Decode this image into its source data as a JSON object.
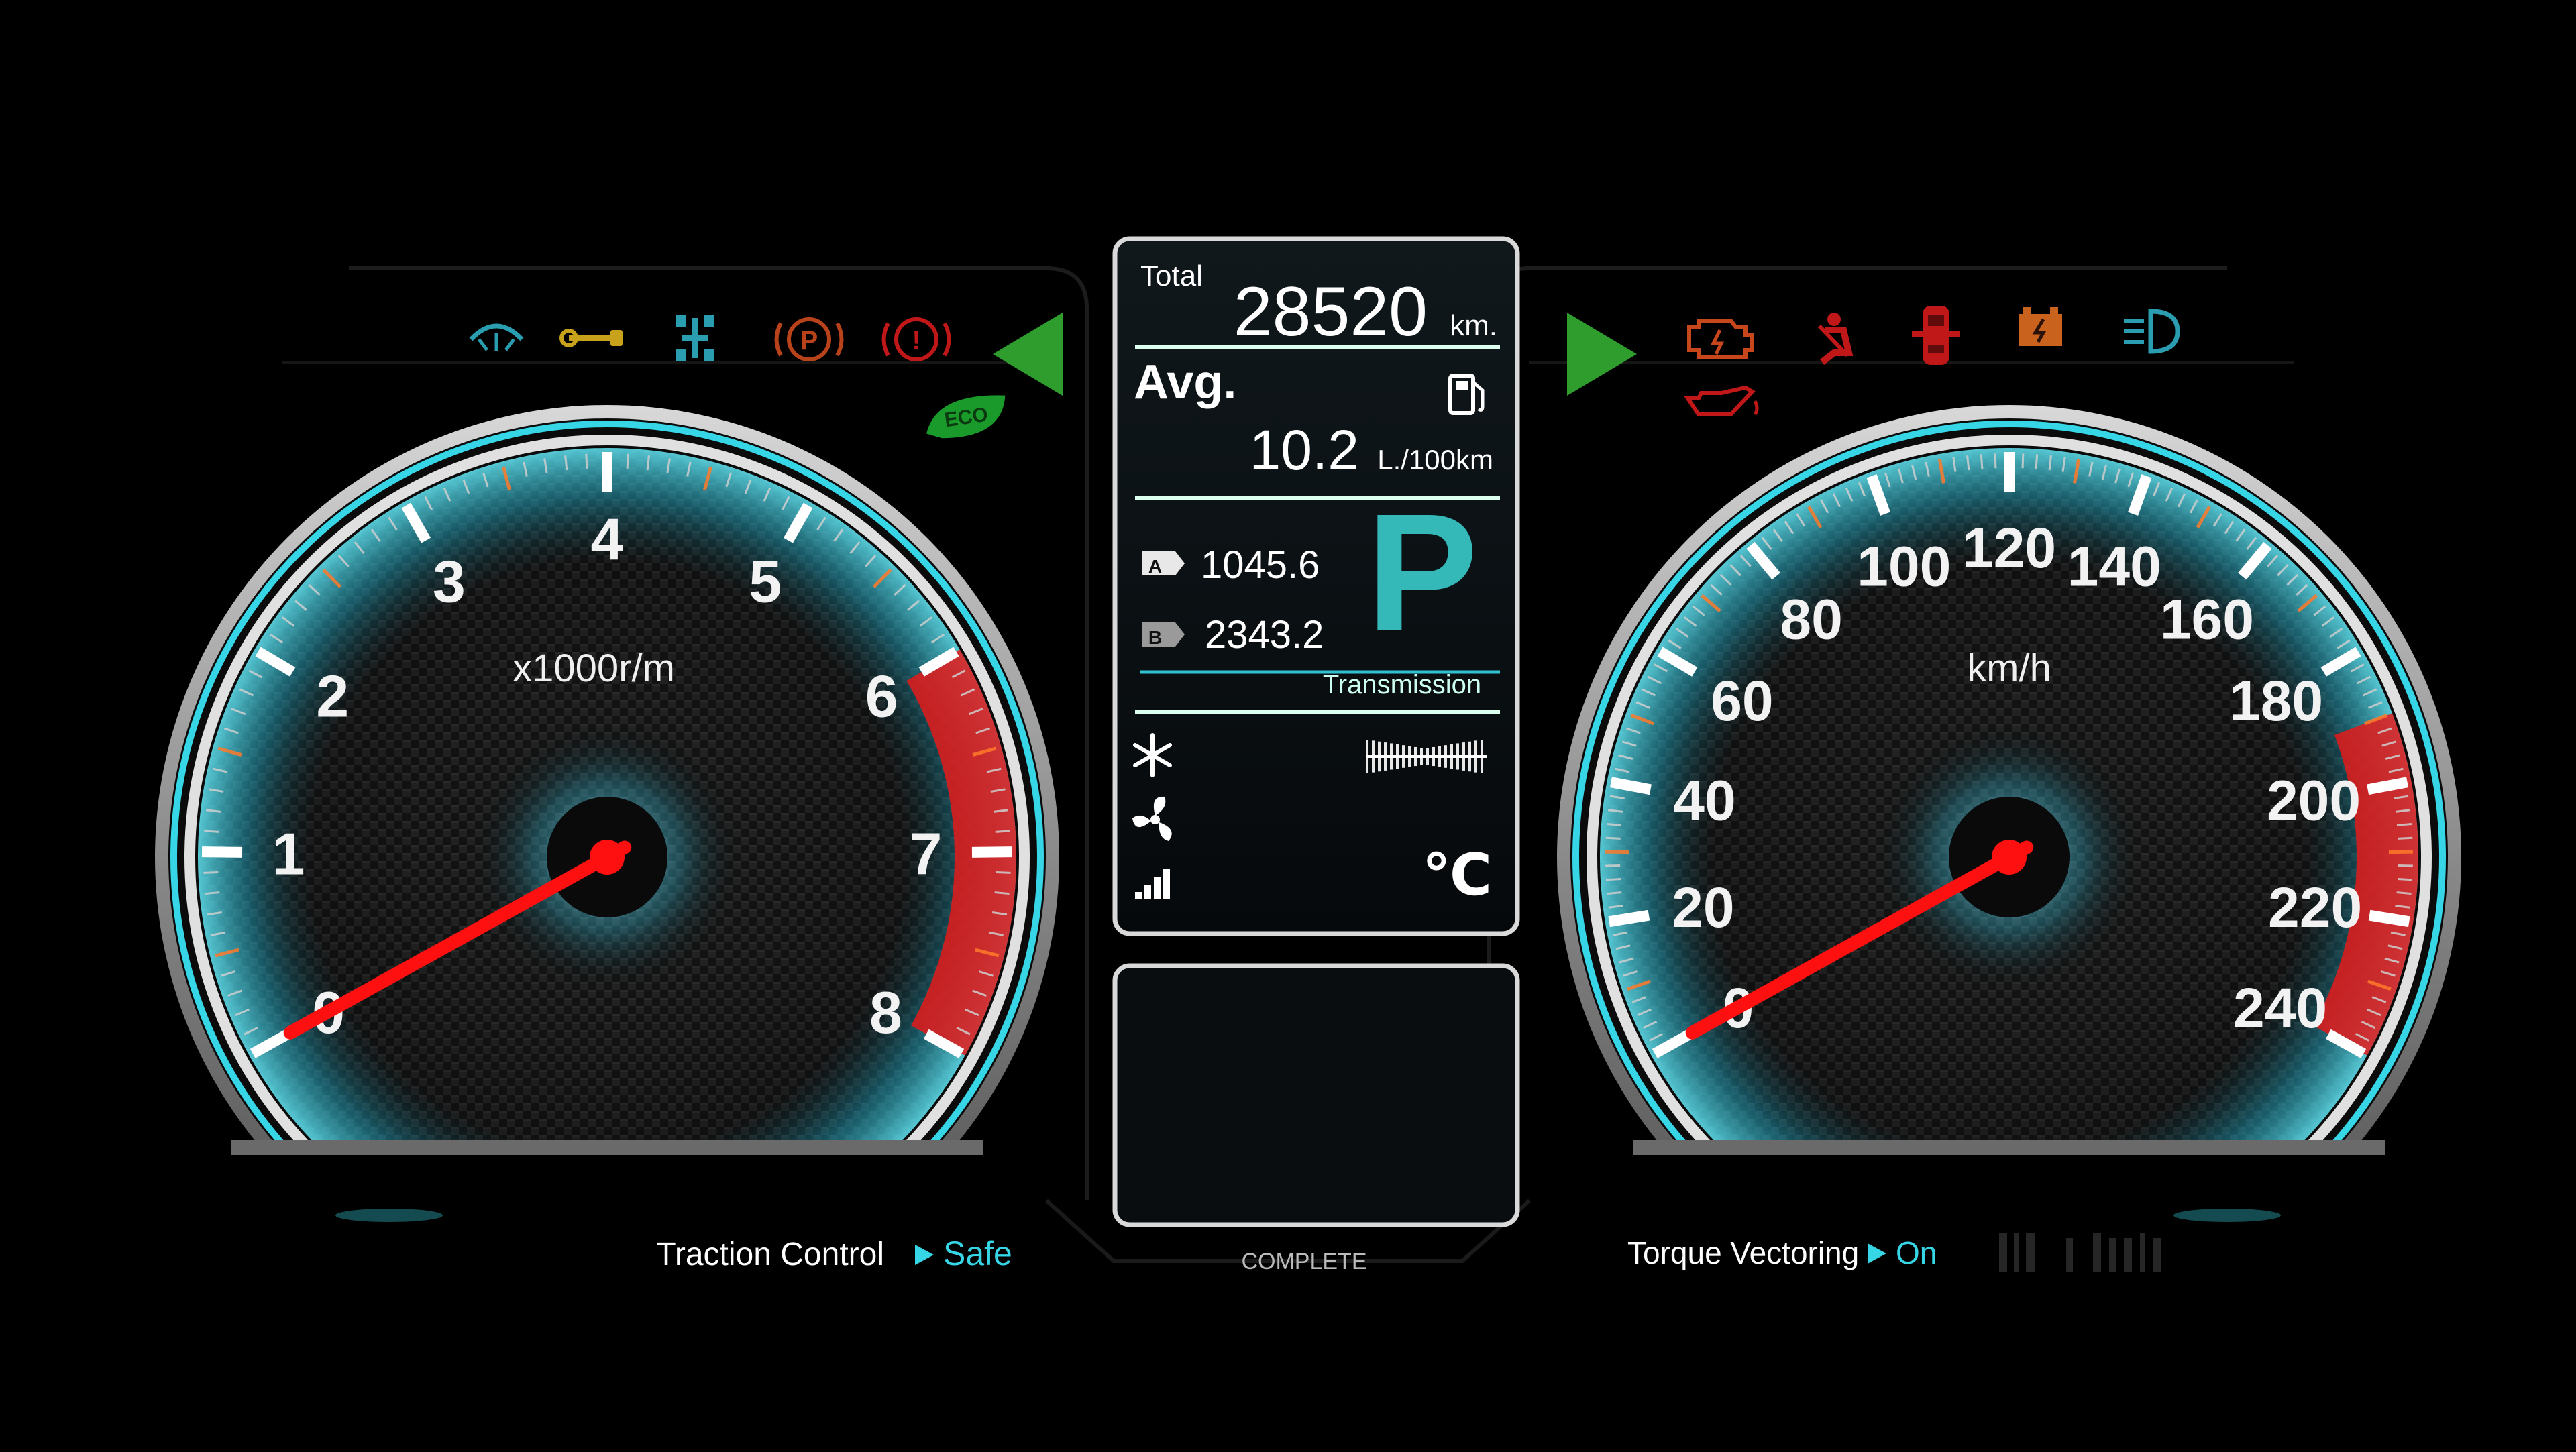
{
  "tachometer": {
    "unit": "x1000r/m",
    "ticks": [
      "0",
      "1",
      "2",
      "3",
      "4",
      "5",
      "6",
      "7",
      "8"
    ],
    "value": 0,
    "max": 8,
    "redline_from": 6
  },
  "speedometer": {
    "unit": "km/h",
    "ticks": [
      "0",
      "20",
      "40",
      "60",
      "80",
      "100",
      "120",
      "140",
      "160",
      "180",
      "200",
      "220",
      "240"
    ],
    "value": 0,
    "max": 240,
    "redline_from": 190
  },
  "center_panel": {
    "total_label": "Total",
    "total_value": "28520",
    "total_unit": "km.",
    "avg_label": "Avg.",
    "avg_value": "10.2",
    "avg_unit": "L./100km",
    "trip_a_badge": "A",
    "trip_a_value": "1045.6",
    "trip_b_badge": "B",
    "trip_b_value": "2343.2",
    "gear": "P",
    "transmission_label": "Transmission",
    "temp_unit": "℃",
    "complete_label": "COMPLETE"
  },
  "warning_lights_left": [
    {
      "icon": "wiper-icon",
      "color": "#2a9db0"
    },
    {
      "icon": "wrench-icon",
      "color": "#c8a21a"
    },
    {
      "icon": "suspension-icon",
      "color": "#2a9db0"
    },
    {
      "icon": "parking-brake-icon",
      "color": "#b8421a"
    },
    {
      "icon": "brake-warning-icon",
      "color": "#c01818"
    }
  ],
  "eco_label": "ECO",
  "warning_lights_right": [
    {
      "icon": "check-engine-icon",
      "color": "#c8461c"
    },
    {
      "icon": "seatbelt-icon",
      "color": "#c01818"
    },
    {
      "icon": "door-open-icon",
      "color": "#c01818"
    },
    {
      "icon": "battery-icon",
      "color": "#c8621c"
    },
    {
      "icon": "headlight-icon",
      "color": "#2a9db0"
    },
    {
      "icon": "oil-pressure-icon",
      "color": "#c01818"
    }
  ],
  "status_left": {
    "label": "Traction Control",
    "value": "Safe"
  },
  "status_right": {
    "label": "Torque Vectoring",
    "value": "On"
  },
  "colors": {
    "accent": "#36d6e6",
    "redline": "#e41a1a",
    "needle": "#ff1010",
    "eco": "#1a9a2a",
    "arrow": "#2e9d2e"
  }
}
